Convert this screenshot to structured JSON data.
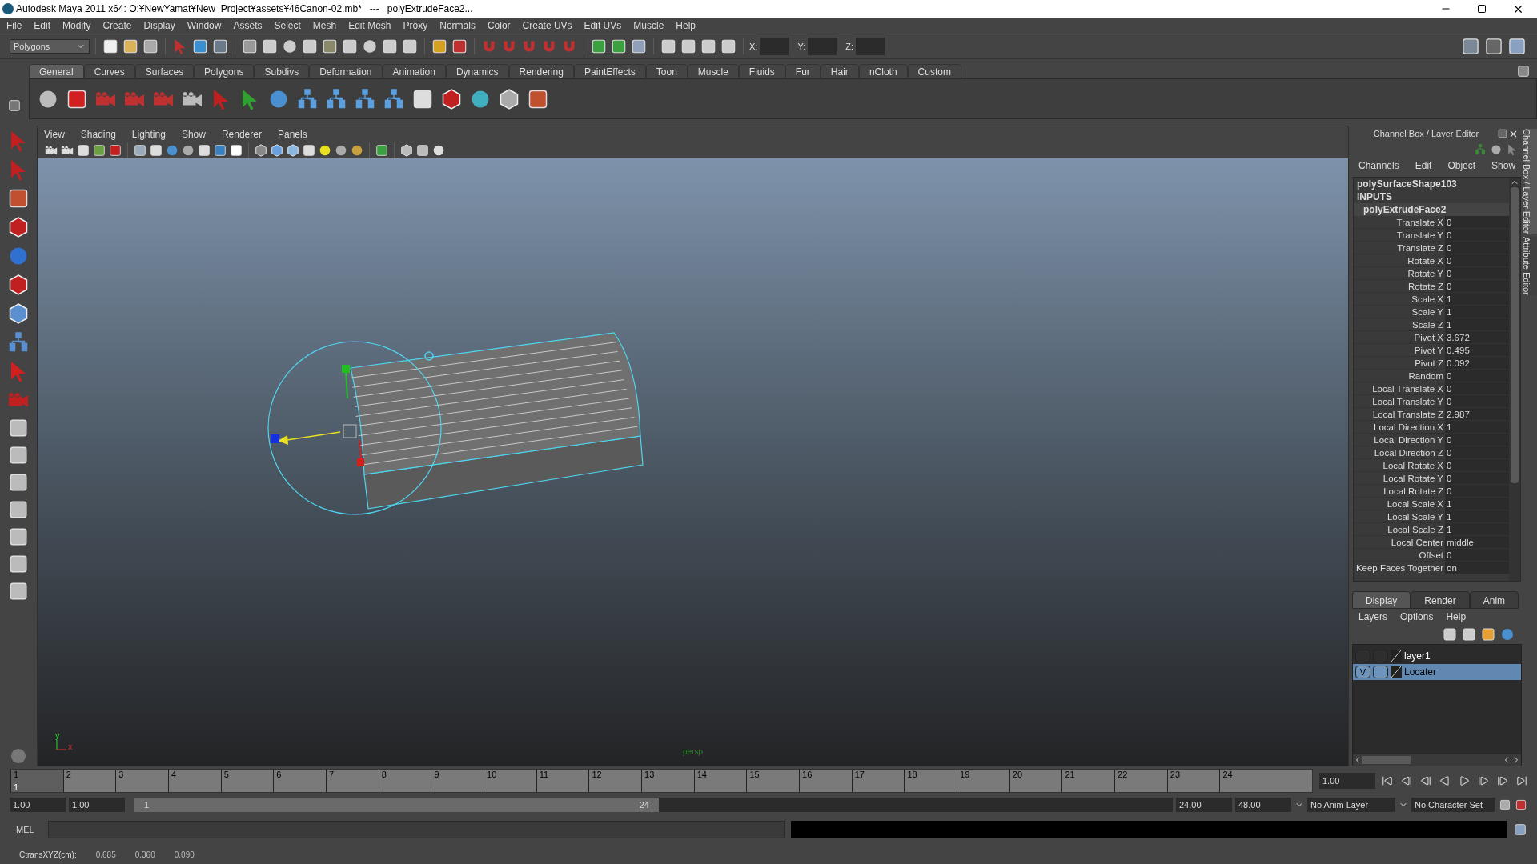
{
  "window": {
    "title": "Autodesk Maya 2011 x64: O:¥NewYamat¥New_Project¥assets¥46Canon-02.mb*   ---   polyExtrudeFace2..."
  },
  "menu_bar": [
    "File",
    "Edit",
    "Modify",
    "Create",
    "Display",
    "Window",
    "Assets",
    "Select",
    "Mesh",
    "Edit Mesh",
    "Proxy",
    "Normals",
    "Color",
    "Create UVs",
    "Edit UVs",
    "Muscle",
    "Help"
  ],
  "status_line": {
    "mode": "Polygons",
    "x_label": "X:",
    "y_label": "Y:",
    "z_label": "Z:"
  },
  "shelf": {
    "tabs": [
      {
        "label": "General",
        "selected": true
      },
      {
        "label": "Curves",
        "selected": false
      },
      {
        "label": "Surfaces",
        "selected": false
      },
      {
        "label": "Polygons",
        "selected": false
      },
      {
        "label": "Subdivs",
        "selected": false
      },
      {
        "label": "Deformation",
        "selected": false
      },
      {
        "label": "Animation",
        "selected": false
      },
      {
        "label": "Dynamics",
        "selected": false
      },
      {
        "label": "Rendering",
        "selected": false
      },
      {
        "label": "PaintEffects",
        "selected": false
      },
      {
        "label": "Toon",
        "selected": false
      },
      {
        "label": "Muscle",
        "selected": false
      },
      {
        "label": "Fluids",
        "selected": false
      },
      {
        "label": "Fur",
        "selected": false
      },
      {
        "label": "Hair",
        "selected": false
      },
      {
        "label": "nCloth",
        "selected": false
      },
      {
        "label": "Custom",
        "selected": false
      }
    ]
  },
  "viewport": {
    "menu": [
      "View",
      "Shading",
      "Lighting",
      "Show",
      "Renderer",
      "Panels"
    ],
    "camera_label": "persp",
    "axis_y": "y",
    "axis_x": "x"
  },
  "channel_box": {
    "title": "Channel Box / Layer Editor",
    "menu": [
      "Channels",
      "Edit",
      "Object",
      "Show"
    ],
    "object": "polySurfaceShape103",
    "inputs_header": "INPUTS",
    "node": "polyExtrudeFace2",
    "attributes": [
      {
        "name": "Translate X",
        "value": "0"
      },
      {
        "name": "Translate Y",
        "value": "0"
      },
      {
        "name": "Translate Z",
        "value": "0"
      },
      {
        "name": "Rotate X",
        "value": "0"
      },
      {
        "name": "Rotate Y",
        "value": "0"
      },
      {
        "name": "Rotate Z",
        "value": "0"
      },
      {
        "name": "Scale X",
        "value": "1"
      },
      {
        "name": "Scale Y",
        "value": "1"
      },
      {
        "name": "Scale Z",
        "value": "1"
      },
      {
        "name": "Pivot X",
        "value": "3.672"
      },
      {
        "name": "Pivot Y",
        "value": "0.495"
      },
      {
        "name": "Pivot Z",
        "value": "0.092"
      },
      {
        "name": "Random",
        "value": "0"
      },
      {
        "name": "Local Translate X",
        "value": "0"
      },
      {
        "name": "Local Translate Y",
        "value": "0"
      },
      {
        "name": "Local Translate Z",
        "value": "2.987"
      },
      {
        "name": "Local Direction X",
        "value": "1"
      },
      {
        "name": "Local Direction Y",
        "value": "0"
      },
      {
        "name": "Local Direction Z",
        "value": "0"
      },
      {
        "name": "Local Rotate X",
        "value": "0"
      },
      {
        "name": "Local Rotate Y",
        "value": "0"
      },
      {
        "name": "Local Rotate Z",
        "value": "0"
      },
      {
        "name": "Local Scale X",
        "value": "1"
      },
      {
        "name": "Local Scale Y",
        "value": "1"
      },
      {
        "name": "Local Scale Z",
        "value": "1"
      },
      {
        "name": "Local Center",
        "value": "middle"
      },
      {
        "name": "Offset",
        "value": "0"
      },
      {
        "name": "Keep Faces Together",
        "value": "on"
      }
    ],
    "side_tabs": [
      {
        "label": "Channel Box / Layer Editor",
        "selected": true
      },
      {
        "label": "Attribute Editor",
        "selected": false
      }
    ]
  },
  "layer_editor": {
    "tabs": [
      {
        "label": "Display",
        "selected": true
      },
      {
        "label": "Render",
        "selected": false
      },
      {
        "label": "Anim",
        "selected": false
      }
    ],
    "menu": [
      "Layers",
      "Options",
      "Help"
    ],
    "visible_mark": "V",
    "layers": [
      {
        "name": "layer1",
        "visible": false,
        "selected": false
      },
      {
        "name": "Locater",
        "visible": true,
        "selected": true
      }
    ]
  },
  "time_slider": {
    "frames": [
      {
        "label": "1",
        "selected": true
      },
      {
        "label": "2",
        "selected": false
      },
      {
        "label": "3",
        "selected": false
      },
      {
        "label": "4",
        "selected": false
      },
      {
        "label": "5",
        "selected": false
      },
      {
        "label": "6",
        "selected": false
      },
      {
        "label": "7",
        "selected": false
      },
      {
        "label": "8",
        "selected": false
      },
      {
        "label": "9",
        "selected": false
      },
      {
        "label": "10",
        "selected": false
      },
      {
        "label": "11",
        "selected": false
      },
      {
        "label": "12",
        "selected": false
      },
      {
        "label": "13",
        "selected": false
      },
      {
        "label": "14",
        "selected": false
      },
      {
        "label": "15",
        "selected": false
      },
      {
        "label": "16",
        "selected": false
      },
      {
        "label": "17",
        "selected": false
      },
      {
        "label": "18",
        "selected": false
      },
      {
        "label": "19",
        "selected": false
      },
      {
        "label": "20",
        "selected": false
      },
      {
        "label": "21",
        "selected": false
      },
      {
        "label": "22",
        "selected": false
      },
      {
        "label": "23",
        "selected": false
      },
      {
        "label": "24",
        "selected": false
      }
    ],
    "current_frame": "1",
    "current_time": "1.00"
  },
  "range_slider": {
    "start_time": "1.00",
    "playback_start": "1.00",
    "range_start": "1",
    "range_end": "24",
    "playback_end": "24.00",
    "end_time": "48.00",
    "anim_layer": "No Anim Layer",
    "character_set": "No Character Set"
  },
  "command_line": {
    "language": "MEL"
  },
  "help_line": {
    "label": "CtransXYZ(cm):",
    "values": [
      "0.685",
      "0.360",
      "0.090"
    ]
  }
}
